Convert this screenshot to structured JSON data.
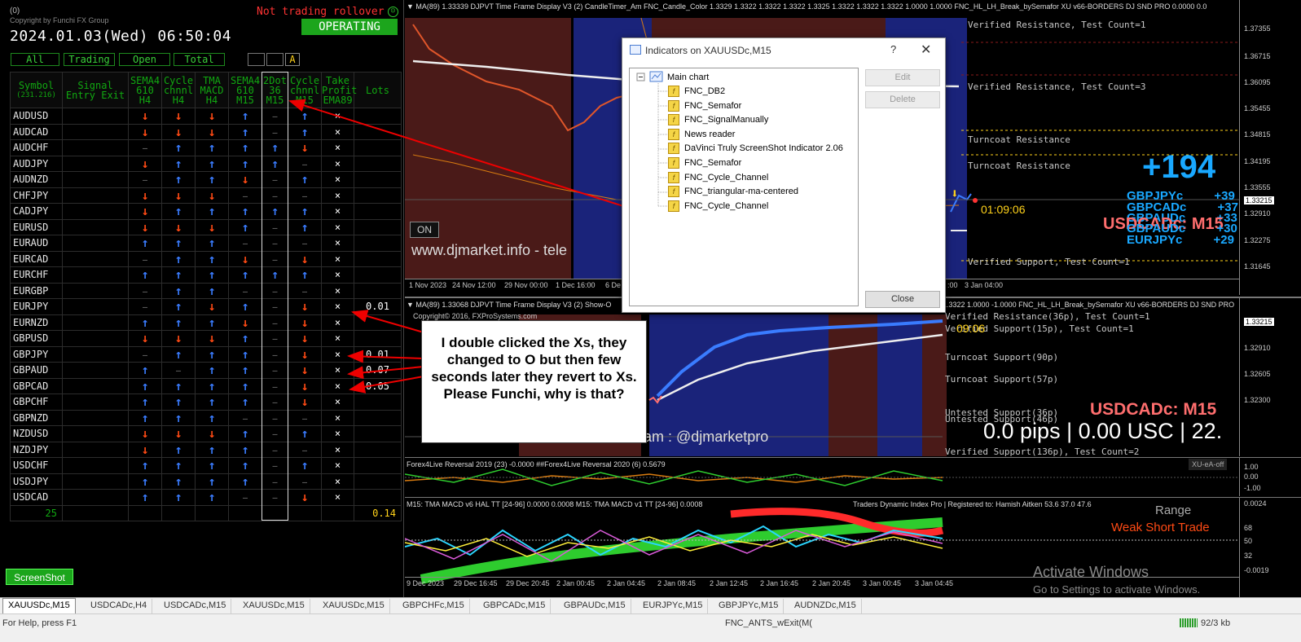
{
  "left_panel": {
    "top_label": "(0)",
    "copyright": "Copyright by Funchi FX Group",
    "rollover": "Not trading rollover",
    "datetime": "2024.01.03(Wed) 06:50:04",
    "operating": "OPERATING",
    "filters": [
      "All",
      "Trading",
      "Open",
      "Total"
    ],
    "filter_a": "A",
    "headers": [
      {
        "l1": "Symbol",
        "l2": "(231.216)"
      },
      {
        "l1": "Signal",
        "l2": "Entry Exit"
      },
      {
        "l1": "SEMA4",
        "l2": "610",
        "l3": "H4"
      },
      {
        "l1": "Cycle",
        "l2": "chnnl",
        "l3": "H4"
      },
      {
        "l1": "TMA",
        "l2": "MACD",
        "l3": "H4"
      },
      {
        "l1": "SEMA4",
        "l2": "610",
        "l3": "M15"
      },
      {
        "l1": "2Dot",
        "l2": "36",
        "l3": "M15"
      },
      {
        "l1": "Cycle",
        "l2": "chnnl",
        "l3": "M15"
      },
      {
        "l1": "Take",
        "l2": "Profit",
        "l3": "EMA89"
      },
      {
        "l1": "Lots"
      }
    ],
    "rows": [
      {
        "sym": "AUDUSD",
        "c": [
          "dn",
          "dn",
          "dn",
          "up",
          "na",
          "up"
        ],
        "tp": "×",
        "lots": ""
      },
      {
        "sym": "AUDCAD",
        "c": [
          "dn",
          "dn",
          "dn",
          "up",
          "na",
          "up"
        ],
        "tp": "×",
        "lots": ""
      },
      {
        "sym": "AUDCHF",
        "c": [
          "na",
          "up",
          "up",
          "up",
          "up",
          "dn"
        ],
        "tp": "×",
        "lots": ""
      },
      {
        "sym": "AUDJPY",
        "c": [
          "dn",
          "up",
          "up",
          "up",
          "up",
          "na"
        ],
        "tp": "×",
        "lots": ""
      },
      {
        "sym": "AUDNZD",
        "c": [
          "na",
          "up",
          "up",
          "dn",
          "na",
          "up"
        ],
        "tp": "×",
        "lots": ""
      },
      {
        "sym": "CHFJPY",
        "c": [
          "dn",
          "dn",
          "dn",
          "na",
          "na",
          "na"
        ],
        "tp": "×",
        "lots": ""
      },
      {
        "sym": "CADJPY",
        "c": [
          "dn",
          "up",
          "up",
          "up",
          "up",
          "up"
        ],
        "tp": "×",
        "lots": ""
      },
      {
        "sym": "EURUSD",
        "c": [
          "dn",
          "dn",
          "dn",
          "up",
          "na",
          "up"
        ],
        "tp": "×",
        "lots": ""
      },
      {
        "sym": "EURAUD",
        "c": [
          "up",
          "up",
          "up",
          "na",
          "na",
          "na"
        ],
        "tp": "×",
        "lots": ""
      },
      {
        "sym": "EURCAD",
        "c": [
          "na",
          "up",
          "up",
          "dn",
          "na",
          "dn"
        ],
        "tp": "×",
        "lots": ""
      },
      {
        "sym": "EURCHF",
        "c": [
          "up",
          "up",
          "up",
          "up",
          "up",
          "up"
        ],
        "tp": "×",
        "lots": ""
      },
      {
        "sym": "EURGBP",
        "c": [
          "na",
          "up",
          "up",
          "na",
          "na",
          "na"
        ],
        "tp": "×",
        "lots": ""
      },
      {
        "sym": "EURJPY",
        "c": [
          "na",
          "up",
          "dn",
          "up",
          "na",
          "dn"
        ],
        "tp": "×",
        "lots": "0.01"
      },
      {
        "sym": "EURNZD",
        "c": [
          "up",
          "up",
          "up",
          "dn",
          "na",
          "dn"
        ],
        "tp": "×",
        "lots": ""
      },
      {
        "sym": "GBPUSD",
        "c": [
          "dn",
          "dn",
          "dn",
          "up",
          "na",
          "dn"
        ],
        "tp": "×",
        "lots": ""
      },
      {
        "sym": "GBPJPY",
        "c": [
          "na",
          "up",
          "up",
          "up",
          "na",
          "dn"
        ],
        "tp": "×",
        "lots": "0.01"
      },
      {
        "sym": "GBPAUD",
        "c": [
          "up",
          "na",
          "up",
          "up",
          "na",
          "dn"
        ],
        "tp": "×",
        "lots": "0.07"
      },
      {
        "sym": "GBPCAD",
        "c": [
          "up",
          "up",
          "up",
          "up",
          "na",
          "dn"
        ],
        "tp": "×",
        "lots": "0.05"
      },
      {
        "sym": "GBPCHF",
        "c": [
          "up",
          "up",
          "up",
          "up",
          "na",
          "dn"
        ],
        "tp": "×",
        "lots": ""
      },
      {
        "sym": "GBPNZD",
        "c": [
          "up",
          "up",
          "up",
          "na",
          "na",
          "na"
        ],
        "tp": "×",
        "lots": ""
      },
      {
        "sym": "NZDUSD",
        "c": [
          "dn",
          "dn",
          "dn",
          "up",
          "na",
          "up"
        ],
        "tp": "×",
        "lots": ""
      },
      {
        "sym": "NZDJPY",
        "c": [
          "dn",
          "up",
          "up",
          "up",
          "na",
          "na"
        ],
        "tp": "×",
        "lots": ""
      },
      {
        "sym": "USDCHF",
        "c": [
          "up",
          "up",
          "up",
          "up",
          "na",
          "up"
        ],
        "tp": "×",
        "lots": ""
      },
      {
        "sym": "USDJPY",
        "c": [
          "up",
          "up",
          "up",
          "up",
          "na",
          "na"
        ],
        "tp": "×",
        "lots": ""
      },
      {
        "sym": "USDCAD",
        "c": [
          "up",
          "up",
          "up",
          "na",
          "na",
          "dn"
        ],
        "tp": "×",
        "lots": ""
      }
    ],
    "total_count": "25",
    "total_lots": "0.14",
    "screenshot_btn": "ScreenShot"
  },
  "chart_top": {
    "header": "▼ MA(89) 1.33339  DJPVT  Time Frame Display V3 (2)  CandleTimer_Am    FNC_Candle_Color 1.3329  1.3322  1.3322  1.3322  1.3325  1.3322  1.3322  1.3322  1.0000  1.0000    FNC_HL_LH_Break_bySemafor  XU v66-BORDERS  DJ SND PRO 0.0000  0.0",
    "prices": [
      "1.37355",
      "1.36715",
      "1.36095",
      "1.35455",
      "1.34815",
      "1.34195",
      "1.33555",
      "1.33215",
      "1.32910",
      "1.32275",
      "1.31645"
    ],
    "times": [
      "1 Nov 2023",
      "24 Nov 12:00",
      "29 Nov 00:00",
      "1 Dec 16:00",
      "6 De",
      ":00",
      "3 Jan 04:00"
    ],
    "sr_labels": [
      "Verified Resistance, Test Count=1",
      "Verified Resistance, Test Count=3",
      "Turncoat Resistance",
      "Turncoat Resistance",
      "Verified Support, Test Count=1"
    ],
    "big_number": "+194",
    "scores": [
      {
        "pair": "GBPJPYc",
        "val": "+39"
      },
      {
        "pair": "GBPCADc",
        "val": "+37"
      },
      {
        "pair": "GBPAUDc",
        "val": "+33"
      },
      {
        "pair": "GBPAUDc",
        "val": "+30"
      },
      {
        "pair": "EURJPYc",
        "val": "+29"
      }
    ],
    "overlay_usdcad": "USDCADc: M15",
    "on_btn": "ON",
    "watermark": "www.djmarket.info   -   tele",
    "timer": "01:09:06"
  },
  "chart_mid": {
    "header": "▼ MA(89) 1.33068  DJPVT  Time Frame Display V3 (2)  Show-O",
    "header_right": "1.3322  1.0000  -1.0000  FNC_HL_LH_Break_bySemafor  XU v66-BORDERS  DJ SND PRO",
    "copyright": "Copyright© 2016, FXProSystems.com",
    "prices": [
      "1.33215",
      "1.32910",
      "1.32605",
      "1.32300"
    ],
    "sr_labels": [
      "Verified Resistance(36p), Test Count=1",
      "Verified Support(15p), Test Count=1",
      "Turncoat Support(90p)",
      "Turncoat Support(57p)",
      "Untested Support(36p)",
      "Untested Support(46p)",
      "Verified Support(136p), Test Count=2"
    ],
    "timer": "09:06",
    "usdcad_label": "USDCADc: M15",
    "pips": "0.0 pips | 0.00 USC | 22.",
    "watermark": "am : @djmarketpro"
  },
  "chart_rev": {
    "header": "Forex4Live Reversal 2019 (23) -0.0000  ##Forex4Live Reversal 2020 (6) 0.5679",
    "prices": [
      "1.00",
      "0.00",
      "-1.00"
    ],
    "xu_btn": "XU-eA-off"
  },
  "chart_bot": {
    "header": "M15: TMA MACD v6 HAL TT [24-96] 0.0000 0.0008  M15: TMA MACD v1 TT [24-96] 0.0008",
    "header_right": "Traders Dynamic Index Pro | Registered to: Hamish Aitken 53.6 37.0 47.6",
    "prices": [
      "0.0024",
      "68",
      "50",
      "32",
      "-0.0019"
    ],
    "times": [
      "9 Dec 2023",
      "29 Dec 16:45",
      "29 Dec 20:45",
      "2 Jan 00:45",
      "2 Jan 04:45",
      "2 Jan 08:45",
      "2 Jan 12:45",
      "2 Jan 16:45",
      "2 Jan 20:45",
      "3 Jan 00:45",
      "3 Jan 04:45"
    ],
    "range": "Range",
    "weak": "Weak Short Trade",
    "activate": "Activate Windows",
    "activate_sub": "Go to Settings to activate Windows."
  },
  "dialog": {
    "title": "Indicators on XAUUSDc,M15",
    "help": "?",
    "root": "Main chart",
    "items": [
      "FNC_DB2",
      "FNC_Semafor",
      "FNC_SignalManually",
      "News reader",
      "DaVinci Truly ScreenShot Indicator 2.06",
      "FNC_Semafor",
      "FNC_Cycle_Channel",
      "FNC_triangular-ma-centered",
      "FNC_Cycle_Channel"
    ],
    "edit": "Edit",
    "delete": "Delete",
    "close": "Close"
  },
  "callout": {
    "text": "I double clicked the Xs, they changed to O but then few seconds later they revert to Xs. Please Funchi, why is that?",
    "question": "?"
  },
  "tabs": [
    "XAUUSDc,M15",
    "USDCADc,H4",
    "USDCADc,M15",
    "XAUUSDc,M15",
    "XAUUSDc,M15",
    "GBPCHFc,M15",
    "GBPCADc,M15",
    "GBPAUDc,M15",
    "EURJPYc,M15",
    "GBPJPYc,M15",
    "AUDNZDc,M15"
  ],
  "status": {
    "help": "For Help, press F1",
    "indicator": "FNC_ANTS_wExit(M(",
    "kb": "92/3 kb"
  }
}
